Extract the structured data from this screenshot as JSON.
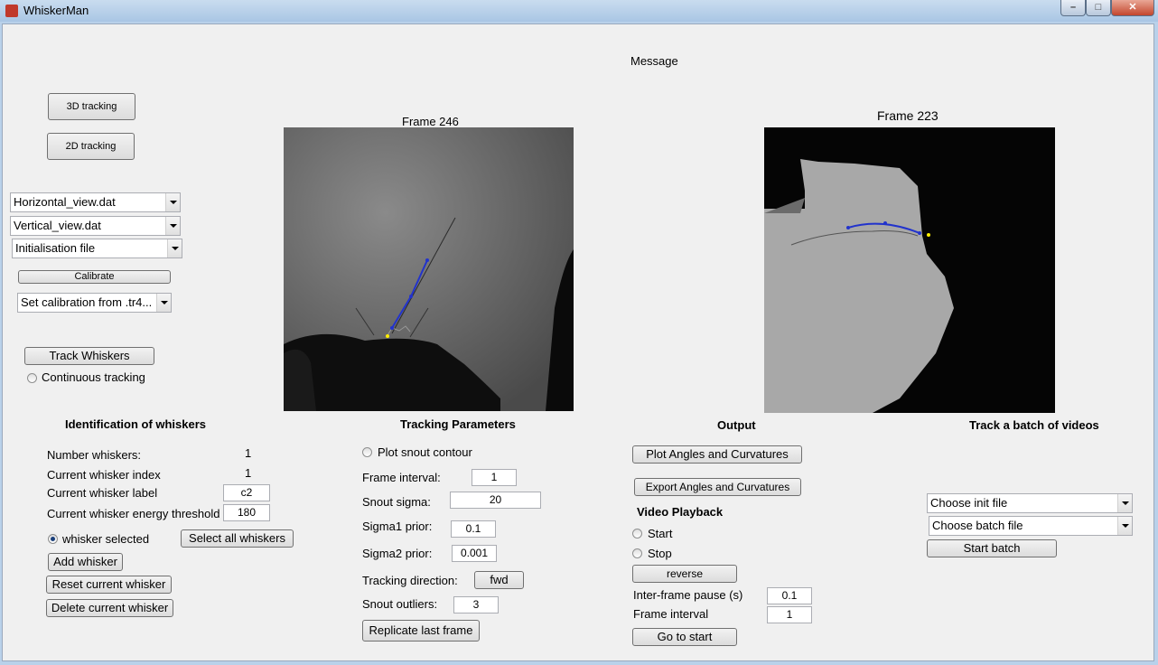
{
  "window": {
    "title": "WhiskerMan"
  },
  "message": "Message",
  "left": {
    "btn_3d": "3D tracking",
    "btn_2d": "2D tracking",
    "horizontal_file": "Horizontal_view.dat",
    "vertical_file": "Vertical_view.dat",
    "init_file": "Initialisation file",
    "calibrate": "Calibrate",
    "calibration_source": "Set calibration from .tr4...",
    "track_whiskers": "Track Whiskers",
    "continuous_tracking": "Continuous tracking"
  },
  "frames": {
    "left_title": "Frame 246",
    "right_title": "Frame 223"
  },
  "identification": {
    "heading": "Identification of whiskers",
    "number_label": "Number whiskers:",
    "number_value": "1",
    "index_label": "Current whisker index",
    "index_value": "1",
    "label_label": "Current whisker label",
    "label_value": "c2",
    "energy_label": "Current whisker energy threshold",
    "energy_value": "180",
    "whisker_selected": "whisker selected",
    "select_all": "Select all whiskers",
    "add": "Add whisker",
    "reset": "Reset current whisker",
    "delete": "Delete current whisker"
  },
  "tracking": {
    "heading": "Tracking Parameters",
    "plot_snout": "Plot snout contour",
    "frame_interval_label": "Frame interval:",
    "frame_interval_value": "1",
    "snout_sigma_label": "Snout sigma:",
    "snout_sigma_value": "20",
    "sigma1_label": "Sigma1 prior:",
    "sigma1_value": "0.1",
    "sigma2_label": "Sigma2 prior:",
    "sigma2_value": "0.001",
    "direction_label": "Tracking direction:",
    "direction_value": "fwd",
    "outliers_label": "Snout outliers:",
    "outliers_value": "3",
    "replicate": "Replicate last frame"
  },
  "output": {
    "heading": "Output",
    "plot": "Plot Angles and Curvatures",
    "export": "Export Angles and Curvatures"
  },
  "playback": {
    "heading": "Video Playback",
    "start": "Start",
    "stop": "Stop",
    "reverse": "reverse",
    "pause_label": "Inter-frame pause (s)",
    "pause_value": "0.1",
    "interval_label": "Frame interval",
    "interval_value": "1",
    "go_start": "Go to start"
  },
  "batch": {
    "heading": "Track a batch of videos",
    "init_file": "Choose init file",
    "batch_file": "Choose batch file",
    "start": "Start batch"
  }
}
